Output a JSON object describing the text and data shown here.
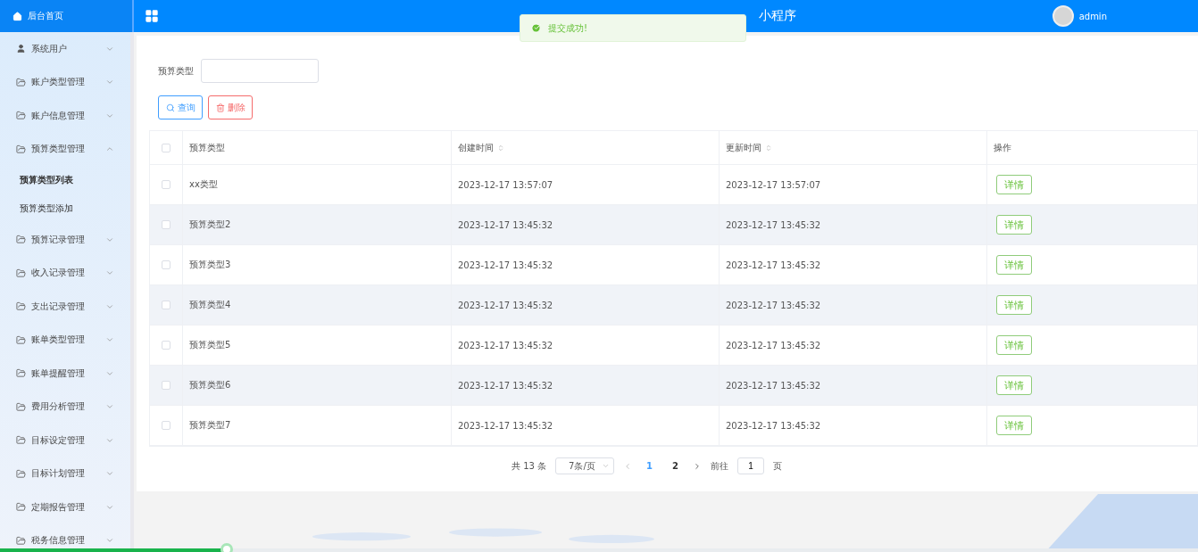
{
  "header": {
    "home_label": "后台首页",
    "title_visible": "小程序",
    "user": "admin"
  },
  "toast": {
    "message": "提交成功!"
  },
  "sidebar": {
    "items": [
      {
        "label": "系统用户",
        "kind": "user",
        "expanded": false
      },
      {
        "label": "账户类型管理",
        "kind": "folder",
        "expanded": false
      },
      {
        "label": "账户信息管理",
        "kind": "folder",
        "expanded": false
      },
      {
        "label": "预算类型管理",
        "kind": "folder",
        "expanded": true,
        "children": [
          {
            "label": "预算类型列表",
            "selected": true
          },
          {
            "label": "预算类型添加",
            "selected": false
          }
        ]
      },
      {
        "label": "预算记录管理",
        "kind": "folder",
        "expanded": false
      },
      {
        "label": "收入记录管理",
        "kind": "folder",
        "expanded": false
      },
      {
        "label": "支出记录管理",
        "kind": "folder",
        "expanded": false
      },
      {
        "label": "账单类型管理",
        "kind": "folder",
        "expanded": false
      },
      {
        "label": "账单提醒管理",
        "kind": "folder",
        "expanded": false
      },
      {
        "label": "费用分析管理",
        "kind": "folder",
        "expanded": false
      },
      {
        "label": "目标设定管理",
        "kind": "folder",
        "expanded": false
      },
      {
        "label": "目标计划管理",
        "kind": "folder",
        "expanded": false
      },
      {
        "label": "定期报告管理",
        "kind": "folder",
        "expanded": false
      },
      {
        "label": "税务信息管理",
        "kind": "folder",
        "expanded": false
      }
    ]
  },
  "search": {
    "label": "预算类型"
  },
  "buttons": [
    {
      "label": "查询",
      "kind": "search"
    },
    {
      "label": "删除",
      "kind": "delete"
    }
  ],
  "table": {
    "select_all_checked": false,
    "columns": [
      {
        "label": "预算类型",
        "kind": "plain"
      },
      {
        "label": "创建时间",
        "kind": "sortable"
      },
      {
        "label": "更新时间",
        "kind": "sortable"
      },
      {
        "label": "操作",
        "kind": "plain"
      }
    ],
    "rows": [
      {
        "type": "xx类型",
        "created": "2023-12-17 13:57:07",
        "updated": "2023-12-17 13:57:07",
        "action": "详情",
        "checked": false
      },
      {
        "type": "预算类型2",
        "created": "2023-12-17 13:45:32",
        "updated": "2023-12-17 13:45:32",
        "action": "详情",
        "checked": false
      },
      {
        "type": "预算类型3",
        "created": "2023-12-17 13:45:32",
        "updated": "2023-12-17 13:45:32",
        "action": "详情",
        "checked": false
      },
      {
        "type": "预算类型4",
        "created": "2023-12-17 13:45:32",
        "updated": "2023-12-17 13:45:32",
        "action": "详情",
        "checked": false
      },
      {
        "type": "预算类型5",
        "created": "2023-12-17 13:45:32",
        "updated": "2023-12-17 13:45:32",
        "action": "详情",
        "checked": false
      },
      {
        "type": "预算类型6",
        "created": "2023-12-17 13:45:32",
        "updated": "2023-12-17 13:45:32",
        "action": "详情",
        "checked": false
      },
      {
        "type": "预算类型7",
        "created": "2023-12-17 13:45:32",
        "updated": "2023-12-17 13:45:32",
        "action": "详情",
        "checked": false
      }
    ]
  },
  "pagination": {
    "total": "共 13 条",
    "page_size": "7条/页",
    "pages": [
      {
        "label": "1",
        "selected": true
      },
      {
        "label": "2",
        "selected": false
      }
    ],
    "goto_label": "前往",
    "goto_value": "1",
    "goto_suffix": "页"
  },
  "loading_bar": {
    "level": 0.19
  }
}
